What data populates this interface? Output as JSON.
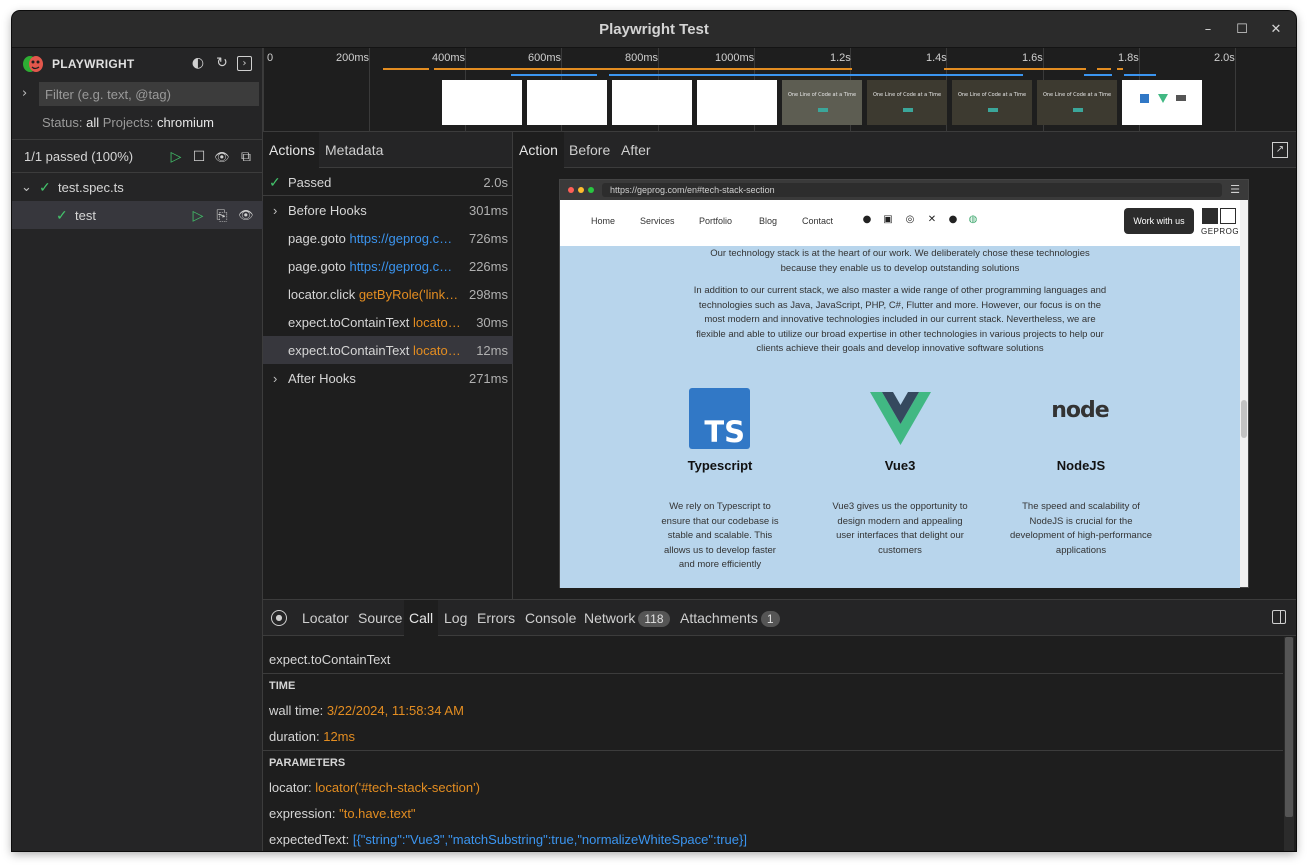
{
  "window": {
    "title": "Playwright Test"
  },
  "brand": {
    "name": "PLAYWRIGHT"
  },
  "filter": {
    "placeholder": "Filter (e.g. text, @tag)"
  },
  "status": {
    "status_label": "Status:",
    "status_value": "all",
    "projects_label": "Projects:",
    "projects_value": "chromium"
  },
  "summary": {
    "passed": "1/1 passed (100%)"
  },
  "tree": {
    "file": "test.spec.ts",
    "test": "test"
  },
  "timeline": {
    "ticks": [
      "0",
      "200ms",
      "400ms",
      "600ms",
      "800ms",
      "1000ms",
      "1.2s",
      "1.4s",
      "1.6s",
      "1.8s",
      "2.0s"
    ],
    "thumbnail_text": "One Line of Code at a Time"
  },
  "actions_tabs": {
    "actions": "Actions",
    "metadata": "Metadata"
  },
  "actions": [
    {
      "title": "Passed",
      "param": "",
      "duration": "2.0s"
    },
    {
      "title": "Before Hooks",
      "param": "",
      "duration": "301ms"
    },
    {
      "title": "page.goto",
      "param": "https://geprog.c…",
      "duration": "726ms"
    },
    {
      "title": "page.goto",
      "param": "https://geprog.c…",
      "duration": "226ms"
    },
    {
      "title": "locator.click",
      "param": "getByRole('link…",
      "duration": "298ms"
    },
    {
      "title": "expect.toContainText",
      "param": "locato…",
      "duration": "30ms"
    },
    {
      "title": "expect.toContainText",
      "param": "locato…",
      "duration": "12ms"
    },
    {
      "title": "After Hooks",
      "param": "",
      "duration": "271ms"
    }
  ],
  "snapshot_tabs": {
    "action": "Action",
    "before": "Before",
    "after": "After"
  },
  "browser": {
    "url": "https://geprog.com/en#tech-stack-section",
    "nav": [
      "Home",
      "Services",
      "Portfolio",
      "Blog",
      "Contact"
    ],
    "cta": "Work with us",
    "logo_text": "GEPROG",
    "intro1": "Our technology stack is at the heart of our work. We deliberately chose these technologies because they enable us to develop outstanding solutions",
    "intro2": "In addition to our current stack, we also master a wide range of other programming languages and technologies such as Java, JavaScript, PHP, C#, Flutter and more. However, our focus is on the most modern and innovative technologies included in our current stack. Nevertheless, we are flexible and able to utilize our broad expertise in other technologies in various projects to help our clients achieve their goals and develop innovative software solutions",
    "techs": [
      {
        "name": "Typescript",
        "logo": "TS",
        "desc": "We rely on Typescript to ensure that our codebase is stable and scalable. This allows us to develop faster and more efficiently"
      },
      {
        "name": "Vue3",
        "logo": "",
        "desc": "Vue3 gives us the opportunity to design modern and appealing user interfaces that delight our customers"
      },
      {
        "name": "NodeJS",
        "logo": "node",
        "desc": "The speed and scalability of NodeJS is crucial for the development of high-performance applications"
      }
    ]
  },
  "details_tabs": {
    "locator": "Locator",
    "source": "Source",
    "call": "Call",
    "log": "Log",
    "errors": "Errors",
    "console": "Console",
    "network": "Network",
    "network_count": "118",
    "attachments": "Attachments",
    "attachments_count": "1"
  },
  "call": {
    "name": "expect.toContainText",
    "time_header": "TIME",
    "wall_label": "wall time:",
    "wall_value": "3/22/2024, 11:58:34 AM",
    "duration_label": "duration:",
    "duration_value": "12ms",
    "params_header": "PARAMETERS",
    "locator_label": "locator:",
    "locator_value": "locator('#tech-stack-section')",
    "expression_label": "expression:",
    "expression_value": "\"to.have.text\"",
    "expected_label": "expectedText:",
    "expected_value": "[{\"string\":\"Vue3\",\"matchSubstring\":true,\"normalizeWhiteSpace\":true}]"
  },
  "colors": {
    "pass": "#43c36b",
    "accent_blue": "#3b95f0",
    "accent_orange": "#e38d21",
    "bg": "#1e1e1e"
  }
}
